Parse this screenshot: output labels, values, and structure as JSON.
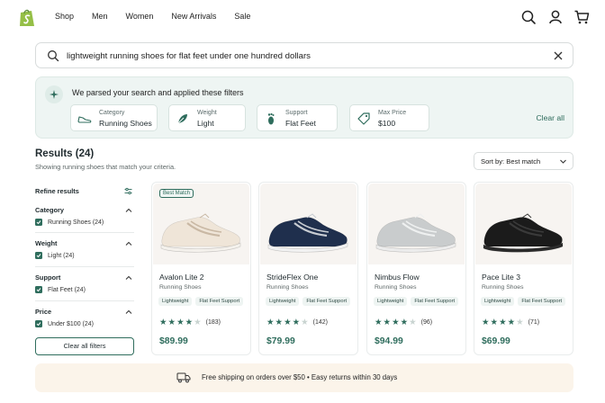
{
  "header": {
    "nav": [
      "Shop",
      "Men",
      "Women",
      "New Arrivals",
      "Sale"
    ]
  },
  "search": {
    "query": "lightweight running shoes for flat feet under one hundred dollars"
  },
  "filters_panel": {
    "title": "We parsed your search and applied these filters",
    "chips": [
      {
        "label": "Category",
        "value": "Running Shoes",
        "icon": "shoe-icon"
      },
      {
        "label": "Weight",
        "value": "Light",
        "icon": "feather-icon"
      },
      {
        "label": "Support",
        "value": "Flat Feet",
        "icon": "foot-icon"
      },
      {
        "label": "Max Price",
        "value": "$100",
        "icon": "price-tag-icon"
      }
    ],
    "clear_label": "Clear all"
  },
  "results": {
    "title": "Results (24)",
    "subtitle": "Showing running shoes that match your criteria.",
    "sort_label": "Sort by: Best match"
  },
  "sidebar": {
    "title": "Refine results",
    "sections": [
      {
        "title": "Category",
        "option": "Running Shoes (24)"
      },
      {
        "title": "Weight",
        "option": "Light (24)"
      },
      {
        "title": "Support",
        "option": "Flat Feet (24)"
      },
      {
        "title": "Price",
        "option": "Under $100 (24)"
      }
    ],
    "clear_button": "Clear all filters"
  },
  "products": [
    {
      "name": "Avalon Lite 2",
      "category": "Running Shoes",
      "tags": [
        "Lightweight",
        "Flat Feet Support"
      ],
      "rating": 4,
      "reviews": "(183)",
      "price": "$89.99",
      "badge": "Best Match",
      "color": "#efe5d8",
      "accent": "#c9b8a4",
      "sole": "#f4f1ec"
    },
    {
      "name": "StrideFlex One",
      "category": "Running Shoes",
      "tags": [
        "Lightweight",
        "Flat Feet Support"
      ],
      "rating": 4,
      "reviews": "(142)",
      "price": "$79.99",
      "badge": "",
      "color": "#1f2f4d",
      "accent": "#c8ccd2",
      "sole": "#f2f2f2"
    },
    {
      "name": "Nimbus Flow",
      "category": "Running Shoes",
      "tags": [
        "Lightweight",
        "Flat Feet Support"
      ],
      "rating": 4,
      "reviews": "(96)",
      "price": "$94.99",
      "badge": "",
      "color": "#c9cccd",
      "accent": "#eef0f0",
      "sole": "#ececec"
    },
    {
      "name": "Pace Lite 3",
      "category": "Running Shoes",
      "tags": [
        "Lightweight",
        "Flat Feet Support"
      ],
      "rating": 4,
      "reviews": "(71)",
      "price": "$69.99",
      "badge": "",
      "color": "#1b1b1b",
      "accent": "#3a3a3a",
      "sole": "#2a2a2a"
    }
  ],
  "banner": {
    "text": "Free shipping on orders over $50  •  Easy returns within 30 days"
  },
  "colors": {
    "accent": "#2f6d5d",
    "brand": "#95bf47",
    "panel": "#eef5f3",
    "banner": "#fbf4ea"
  }
}
